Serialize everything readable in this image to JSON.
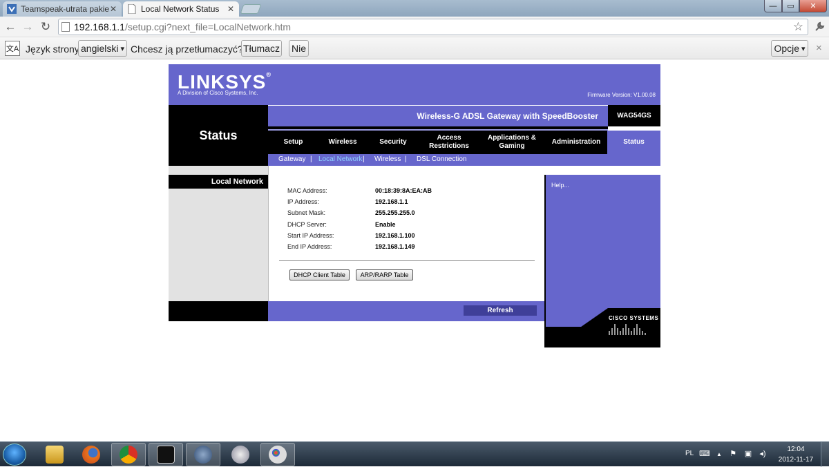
{
  "browser": {
    "tabs": [
      {
        "title": "Teamspeak-utrata pakietów"
      },
      {
        "title": "Local Network Status"
      }
    ],
    "url_host": "192.168.1.1",
    "url_path": "/setup.cgi?next_file=LocalNetwork.htm",
    "window_buttons": {
      "min": "—",
      "max": "▭",
      "close": "✕"
    }
  },
  "translate_bar": {
    "icon": "文A",
    "page_language_label": "Język strony:",
    "language_value": "angielski",
    "question": "Chcesz ją przetłumaczyć?",
    "translate_button": "Tłumacz",
    "no_button": "Nie",
    "options_button": "Opcje",
    "dropdown_arrow": "▾",
    "close": "×"
  },
  "router": {
    "logo": "LINKSYS",
    "logo_reg": "®",
    "logo_sub": "A Division of Cisco Systems, Inc.",
    "firmware": "Firmware Version: V1.00.08",
    "section_title": "Status",
    "product_name": "Wireless-G ADSL Gateway with SpeedBooster",
    "model": "WAG54GS",
    "main_nav": [
      {
        "label": "Setup"
      },
      {
        "label": "Wireless"
      },
      {
        "label": "Security"
      },
      {
        "label": "Access Restrictions"
      },
      {
        "label": "Applications & Gaming"
      },
      {
        "label": "Administration"
      },
      {
        "label": "Status"
      }
    ],
    "sub_nav": [
      {
        "label": "Gateway"
      },
      {
        "label": "Local Network"
      },
      {
        "label": "Wireless"
      },
      {
        "label": "DSL Connection"
      }
    ],
    "sub_nav_sep": "|",
    "left_heading": "Local Network",
    "fields": [
      {
        "label": "MAC Address:",
        "value": "00:18:39:8A:EA:AB"
      },
      {
        "label": "IP Address:",
        "value": "192.168.1.1"
      },
      {
        "label": "Subnet Mask:",
        "value": "255.255.255.0"
      },
      {
        "label": "DHCP Server:",
        "value": "Enable"
      },
      {
        "label": "Start IP Address:",
        "value": "192.168.1.100"
      },
      {
        "label": "End IP Address:",
        "value": "192.168.1.149"
      }
    ],
    "dhcp_table_button": "DHCP Client Table",
    "arp_table_button": "ARP/RARP Table",
    "refresh_button": "Refresh",
    "help_link": "Help...",
    "cisco_logo": "CISCO SYSTEMS"
  },
  "taskbar": {
    "language": "PL",
    "time": "12:04",
    "date": "2012-11-17"
  },
  "colors": {
    "linksys_purple": "#6666cc",
    "linksys_dark": "#3f3f99",
    "active_subnav": "#8fd3ff"
  }
}
